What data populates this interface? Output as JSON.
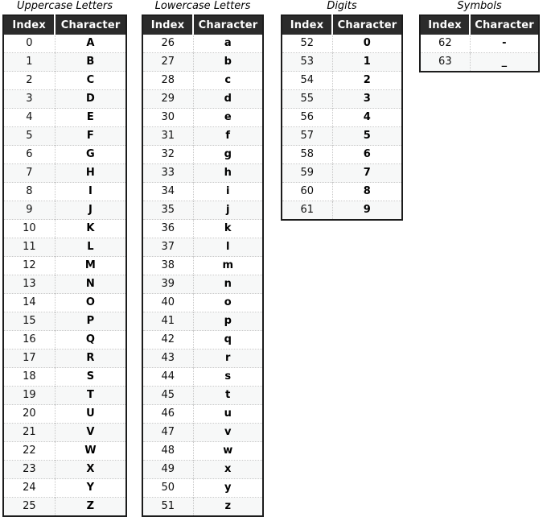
{
  "tables": [
    {
      "id": "uppercase",
      "title": "Uppercase Letters",
      "columns": {
        "index": "Index",
        "character": "Character"
      },
      "rows": [
        {
          "index": "0",
          "character": "A"
        },
        {
          "index": "1",
          "character": "B"
        },
        {
          "index": "2",
          "character": "C"
        },
        {
          "index": "3",
          "character": "D"
        },
        {
          "index": "4",
          "character": "E"
        },
        {
          "index": "5",
          "character": "F"
        },
        {
          "index": "6",
          "character": "G"
        },
        {
          "index": "7",
          "character": "H"
        },
        {
          "index": "8",
          "character": "I"
        },
        {
          "index": "9",
          "character": "J"
        },
        {
          "index": "10",
          "character": "K"
        },
        {
          "index": "11",
          "character": "L"
        },
        {
          "index": "12",
          "character": "M"
        },
        {
          "index": "13",
          "character": "N"
        },
        {
          "index": "14",
          "character": "O"
        },
        {
          "index": "15",
          "character": "P"
        },
        {
          "index": "16",
          "character": "Q"
        },
        {
          "index": "17",
          "character": "R"
        },
        {
          "index": "18",
          "character": "S"
        },
        {
          "index": "19",
          "character": "T"
        },
        {
          "index": "20",
          "character": "U"
        },
        {
          "index": "21",
          "character": "V"
        },
        {
          "index": "22",
          "character": "W"
        },
        {
          "index": "23",
          "character": "X"
        },
        {
          "index": "24",
          "character": "Y"
        },
        {
          "index": "25",
          "character": "Z"
        }
      ]
    },
    {
      "id": "lowercase",
      "title": "Lowercase Letters",
      "columns": {
        "index": "Index",
        "character": "Character"
      },
      "rows": [
        {
          "index": "26",
          "character": "a"
        },
        {
          "index": "27",
          "character": "b"
        },
        {
          "index": "28",
          "character": "c"
        },
        {
          "index": "29",
          "character": "d"
        },
        {
          "index": "30",
          "character": "e"
        },
        {
          "index": "31",
          "character": "f"
        },
        {
          "index": "32",
          "character": "g"
        },
        {
          "index": "33",
          "character": "h"
        },
        {
          "index": "34",
          "character": "i"
        },
        {
          "index": "35",
          "character": "j"
        },
        {
          "index": "36",
          "character": "k"
        },
        {
          "index": "37",
          "character": "l"
        },
        {
          "index": "38",
          "character": "m"
        },
        {
          "index": "39",
          "character": "n"
        },
        {
          "index": "40",
          "character": "o"
        },
        {
          "index": "41",
          "character": "p"
        },
        {
          "index": "42",
          "character": "q"
        },
        {
          "index": "43",
          "character": "r"
        },
        {
          "index": "44",
          "character": "s"
        },
        {
          "index": "45",
          "character": "t"
        },
        {
          "index": "46",
          "character": "u"
        },
        {
          "index": "47",
          "character": "v"
        },
        {
          "index": "48",
          "character": "w"
        },
        {
          "index": "49",
          "character": "x"
        },
        {
          "index": "50",
          "character": "y"
        },
        {
          "index": "51",
          "character": "z"
        }
      ]
    },
    {
      "id": "digits",
      "title": "Digits",
      "columns": {
        "index": "Index",
        "character": "Character"
      },
      "rows": [
        {
          "index": "52",
          "character": "0"
        },
        {
          "index": "53",
          "character": "1"
        },
        {
          "index": "54",
          "character": "2"
        },
        {
          "index": "55",
          "character": "3"
        },
        {
          "index": "56",
          "character": "4"
        },
        {
          "index": "57",
          "character": "5"
        },
        {
          "index": "58",
          "character": "6"
        },
        {
          "index": "59",
          "character": "7"
        },
        {
          "index": "60",
          "character": "8"
        },
        {
          "index": "61",
          "character": "9"
        }
      ]
    },
    {
      "id": "symbols",
      "title": "Symbols",
      "columns": {
        "index": "Index",
        "character": "Character"
      },
      "rows": [
        {
          "index": "62",
          "character": "-"
        },
        {
          "index": "63",
          "character": "_"
        }
      ]
    }
  ],
  "colors": {
    "header_background": "#2b2b2b",
    "header_text": "#ffffff",
    "border": "#1c1c1c",
    "row_separator": "#c8c8c8",
    "row_stripe": "#f7f8f8",
    "page_background": "#ffffff"
  }
}
